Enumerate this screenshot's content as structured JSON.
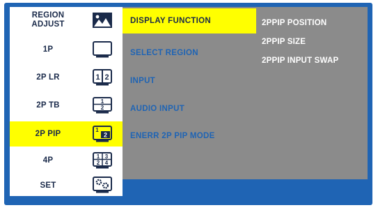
{
  "sidebar": {
    "items": [
      {
        "label": "REGION\nADJUST",
        "icon": "picture-icon"
      },
      {
        "label": "1P",
        "icon": "single-monitor-icon"
      },
      {
        "label": "2P LR",
        "icon": "split-left-right-icon"
      },
      {
        "label": "2P TB",
        "icon": "split-top-bottom-icon"
      },
      {
        "label": "2P PIP",
        "icon": "picture-in-picture-icon",
        "selected": true
      },
      {
        "label": "4P",
        "icon": "quad-split-icon"
      },
      {
        "label": "SET",
        "icon": "settings-monitor-icon"
      }
    ]
  },
  "menu": {
    "items": [
      {
        "label": "DISPLAY FUNCTION",
        "selected": true
      },
      {
        "label": "SELECT REGION"
      },
      {
        "label": "INPUT"
      },
      {
        "label": "AUDIO INPUT"
      },
      {
        "label": "ENERR 2P PIP MODE"
      }
    ]
  },
  "submenu": {
    "items": [
      {
        "label": "2PPIP POSITION"
      },
      {
        "label": "2PPIP SIZE"
      },
      {
        "label": "2PPIP INPUT SWAP"
      }
    ]
  },
  "icon_text": {
    "lr": [
      "1",
      "2"
    ],
    "tb": [
      "1",
      "2"
    ],
    "pip": [
      "1",
      "2"
    ],
    "quad": [
      "1",
      "3",
      "2",
      "4"
    ]
  },
  "colors": {
    "background": "#1f64b4",
    "panel": "#8b8b8b",
    "highlight": "#ffff00",
    "sidebar": "#ffffff"
  }
}
